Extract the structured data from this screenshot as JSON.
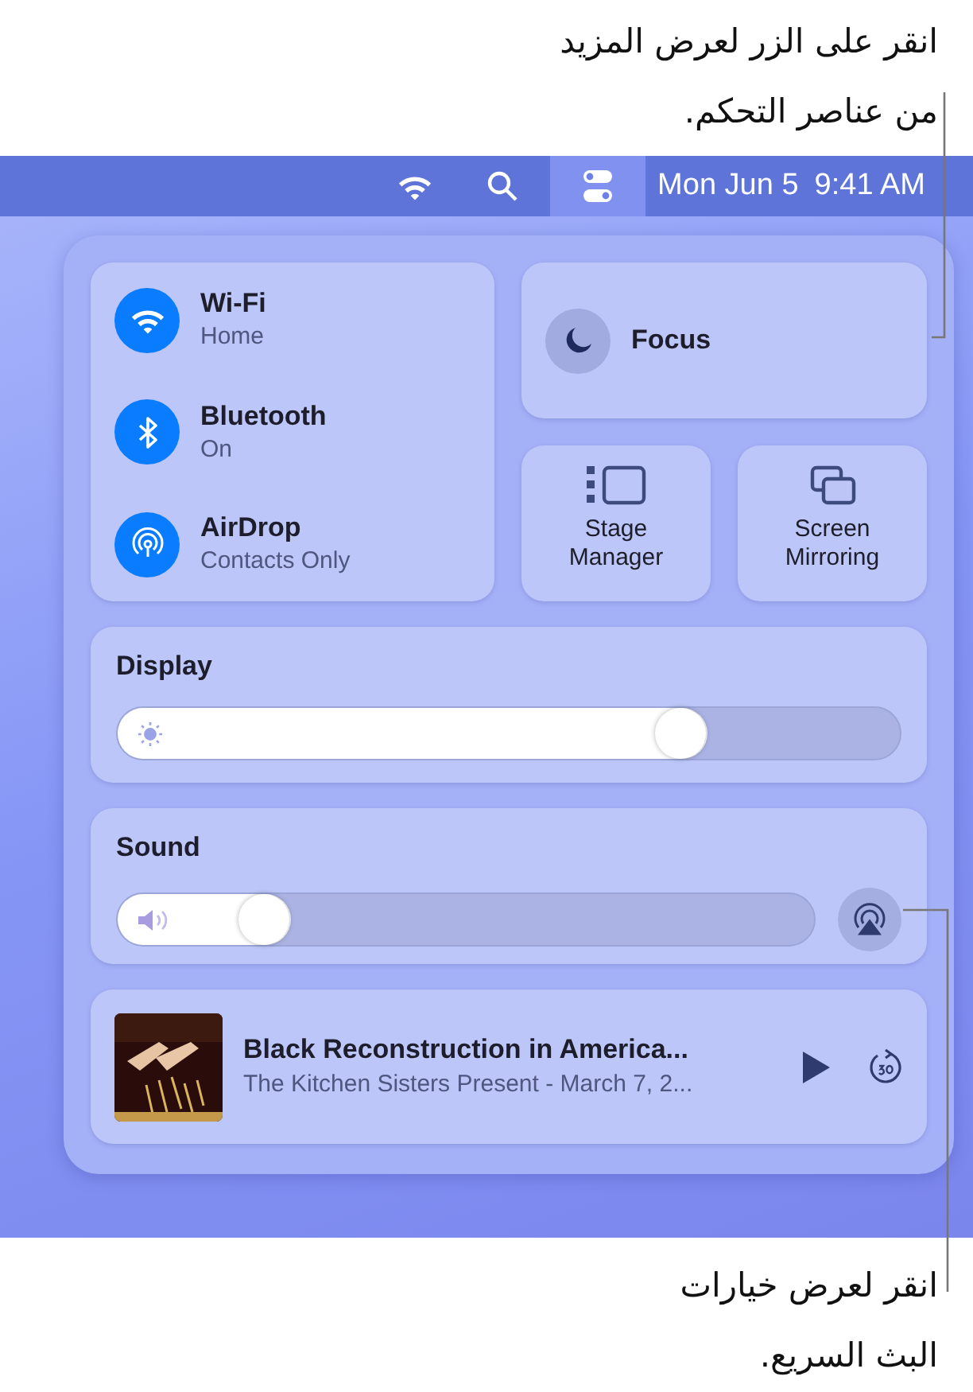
{
  "callout_top": {
    "text": "انقر على الزر لعرض المزيد\nمن عناصر التحكم."
  },
  "menu_bar": {
    "control_center_button": {
      "selected": true
    },
    "date": "Mon Jun 5",
    "time": "9:41 AM"
  },
  "connectivity": [
    {
      "kind": "wifi",
      "title": "Wi-Fi",
      "status": "Home",
      "on": true
    },
    {
      "kind": "bluetooth",
      "title": "Bluetooth",
      "status": "On",
      "on": true
    },
    {
      "kind": "airdrop",
      "title": "AirDrop",
      "status": "Contacts Only",
      "on": true
    }
  ],
  "focus": {
    "label": "Focus",
    "on": false
  },
  "tiles": [
    {
      "kind": "stage",
      "label": "Stage Manager"
    },
    {
      "kind": "mirroring",
      "label": "Screen Mirroring"
    }
  ],
  "display": {
    "title": "Display",
    "level": 0.72
  },
  "sound": {
    "title": "Sound",
    "level": 0.21
  },
  "now_playing": {
    "title": "Black Reconstruction in America...",
    "subtitle": "The Kitchen Sisters Present - March 7, 2..."
  },
  "callout_bottom": {
    "text": "انقر لعرض خيارات\nالبث السريع."
  }
}
